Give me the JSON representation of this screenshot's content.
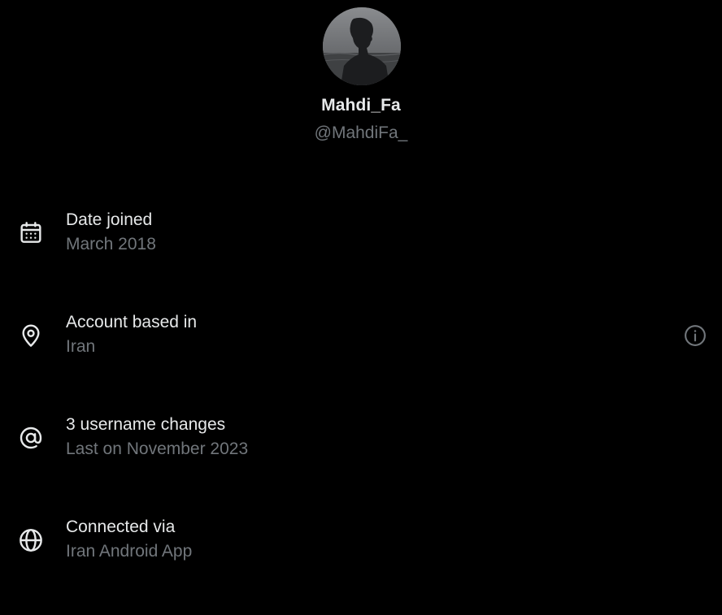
{
  "profile": {
    "display_name": "Mahdi_Fa",
    "handle": "@MahdiFa_",
    "avatar_icon": "profile-photo-silhouette"
  },
  "rows": [
    {
      "icon": "calendar-icon",
      "title": "Date joined",
      "subtitle": "March 2018"
    },
    {
      "icon": "location-pin-icon",
      "title": "Account based in",
      "subtitle": "Iran",
      "action_icon": "info-icon"
    },
    {
      "icon": "at-sign-icon",
      "title": "3 username changes",
      "subtitle": "Last on November 2023"
    },
    {
      "icon": "globe-icon",
      "title": "Connected via",
      "subtitle": "Iran Android App"
    }
  ],
  "colors": {
    "background": "#000000",
    "primary_text": "#e7e9ea",
    "secondary_text": "#71767b"
  }
}
